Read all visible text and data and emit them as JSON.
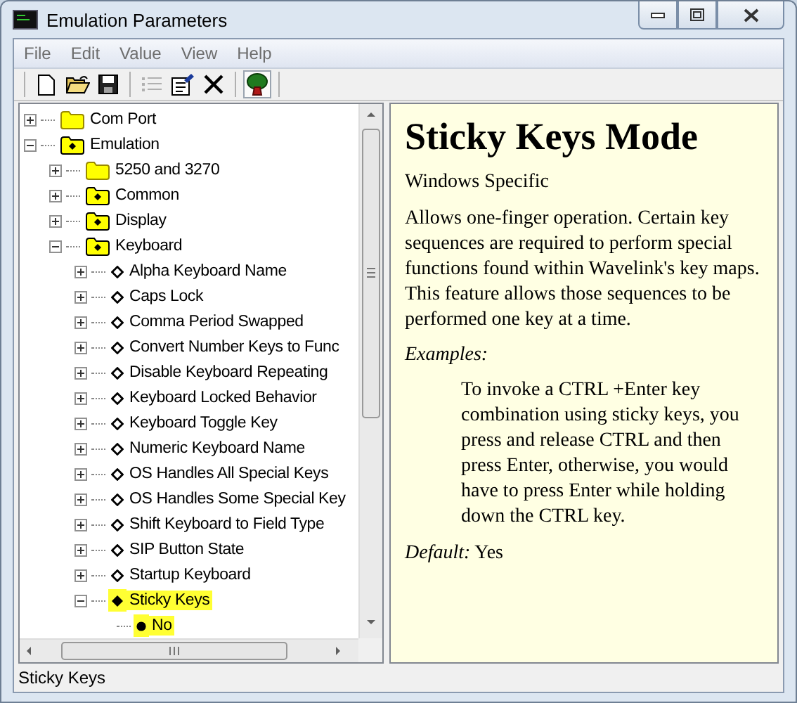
{
  "window": {
    "title": "Emulation Parameters"
  },
  "menu": [
    "File",
    "Edit",
    "Value",
    "View",
    "Help"
  ],
  "toolbar": [
    {
      "kind": "new",
      "disabled": false,
      "pressed": false
    },
    {
      "kind": "open",
      "disabled": false,
      "pressed": false
    },
    {
      "kind": "save",
      "disabled": false,
      "pressed": false
    },
    {
      "kind": "list",
      "disabled": true,
      "pressed": false
    },
    {
      "kind": "properties",
      "disabled": false,
      "pressed": false
    },
    {
      "kind": "delete",
      "disabled": false,
      "pressed": false
    },
    {
      "kind": "tree",
      "disabled": false,
      "pressed": true
    }
  ],
  "tree": [
    {
      "label": "Com Port",
      "kind": "folder",
      "expanded": false,
      "highlighted": false
    },
    {
      "label": "Emulation",
      "kind": "folder-dot",
      "expanded": true,
      "highlighted": false,
      "children": [
        {
          "label": "5250 and 3270",
          "kind": "folder",
          "expanded": false,
          "highlighted": false
        },
        {
          "label": "Common",
          "kind": "folder-dot",
          "expanded": false,
          "highlighted": false
        },
        {
          "label": "Display",
          "kind": "folder-dot",
          "expanded": false,
          "highlighted": false
        },
        {
          "label": "Keyboard",
          "kind": "folder-dot",
          "expanded": true,
          "highlighted": false,
          "children": [
            {
              "label": "Alpha Keyboard Name",
              "kind": "setting",
              "expanded": false,
              "highlighted": false
            },
            {
              "label": "Caps Lock",
              "kind": "setting",
              "expanded": false,
              "highlighted": false
            },
            {
              "label": "Comma Period Swapped",
              "kind": "setting",
              "expanded": false,
              "highlighted": false
            },
            {
              "label": "Convert Number Keys to Func",
              "kind": "setting",
              "expanded": false,
              "highlighted": false
            },
            {
              "label": "Disable Keyboard Repeating",
              "kind": "setting",
              "expanded": false,
              "highlighted": false
            },
            {
              "label": "Keyboard Locked Behavior",
              "kind": "setting",
              "expanded": false,
              "highlighted": false
            },
            {
              "label": "Keyboard Toggle Key",
              "kind": "setting",
              "expanded": false,
              "highlighted": false
            },
            {
              "label": "Numeric Keyboard Name",
              "kind": "setting",
              "expanded": false,
              "highlighted": false
            },
            {
              "label": "OS Handles All Special Keys",
              "kind": "setting",
              "expanded": false,
              "highlighted": false
            },
            {
              "label": "OS Handles Some Special Key",
              "kind": "setting",
              "expanded": false,
              "highlighted": false
            },
            {
              "label": "Shift Keyboard to Field Type",
              "kind": "setting",
              "expanded": false,
              "highlighted": false
            },
            {
              "label": "SIP Button State",
              "kind": "setting",
              "expanded": false,
              "highlighted": false
            },
            {
              "label": "Startup Keyboard",
              "kind": "setting",
              "expanded": false,
              "highlighted": false
            },
            {
              "label": "Sticky Keys",
              "kind": "setting-set",
              "expanded": true,
              "highlighted": true,
              "children": [
                {
                  "label": "No",
                  "kind": "value",
                  "highlighted": true
                }
              ]
            }
          ]
        }
      ]
    }
  ],
  "help": {
    "title": "Sticky Keys Mode",
    "subtitle": "Windows Specific",
    "description": "Allows one-finger operation. Certain key sequences are required to perform special functions found within Wavelink's key maps. This feature allows those sequences to be performed one key at a time.",
    "examples_label": "Examples:",
    "example": "To invoke a CTRL +Enter key combination using sticky keys, you press and release CTRL and then press Enter, otherwise, you would have to press Enter while holding down the CTRL key.",
    "default": "*Default:* Yes"
  },
  "status_bar": "Sticky Keys"
}
